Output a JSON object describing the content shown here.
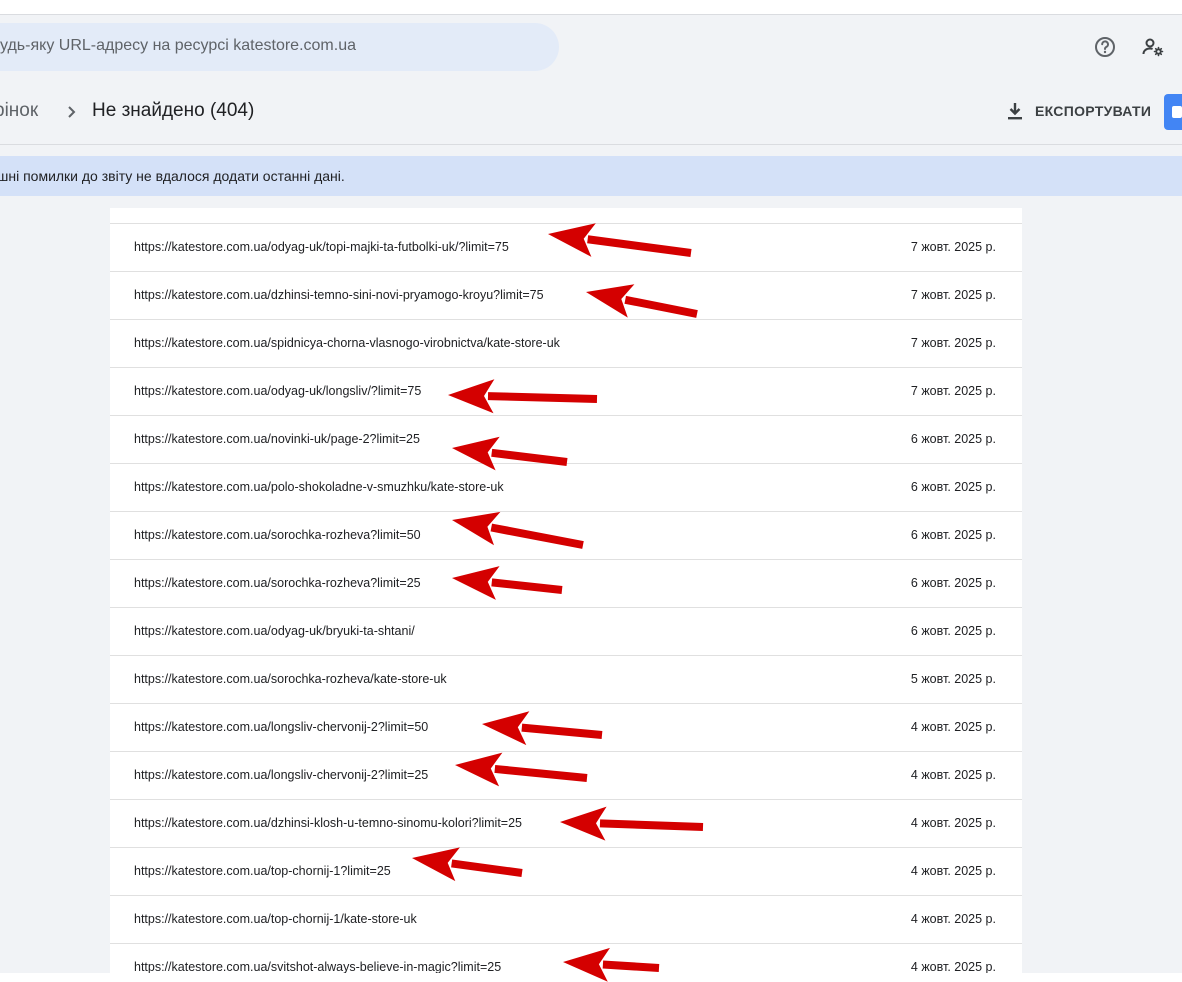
{
  "search": {
    "placeholder": "удь-яку URL-адресу на ресурсі katestore.com.ua"
  },
  "header": {
    "help_icon": "help-circle-icon",
    "account_icon": "manage-accounts-icon"
  },
  "breadcrumb": {
    "parent": "рінок",
    "current": "Не знайдено (404)"
  },
  "toolbar": {
    "export_label": "ЕКСПОРТУВАТИ",
    "export_icon": "download-icon"
  },
  "banner": {
    "text": "ішні помилки до звіту не вдалося додати останні дані."
  },
  "table": {
    "rows": [
      {
        "url": "https://katestore.com.ua/odyag-uk/topi-majki-ta-futbolki-uk/?limit=75",
        "date": "7 жовт. 2025 р."
      },
      {
        "url": "https://katestore.com.ua/dzhinsi-temno-sini-novi-pryamogo-kroyu?limit=75",
        "date": "7 жовт. 2025 р."
      },
      {
        "url": "https://katestore.com.ua/spidnicya-chorna-vlasnogo-virobnictva/kate-store-uk",
        "date": "7 жовт. 2025 р."
      },
      {
        "url": "https://katestore.com.ua/odyag-uk/longsliv/?limit=75",
        "date": "7 жовт. 2025 р."
      },
      {
        "url": "https://katestore.com.ua/novinki-uk/page-2?limit=25",
        "date": "6 жовт. 2025 р."
      },
      {
        "url": "https://katestore.com.ua/polo-shokoladne-v-smuzhku/kate-store-uk",
        "date": "6 жовт. 2025 р."
      },
      {
        "url": "https://katestore.com.ua/sorochka-rozheva?limit=50",
        "date": "6 жовт. 2025 р."
      },
      {
        "url": "https://katestore.com.ua/sorochka-rozheva?limit=25",
        "date": "6 жовт. 2025 р."
      },
      {
        "url": "https://katestore.com.ua/odyag-uk/bryuki-ta-shtani/",
        "date": "6 жовт. 2025 р."
      },
      {
        "url": "https://katestore.com.ua/sorochka-rozheva/kate-store-uk",
        "date": "5 жовт. 2025 р."
      },
      {
        "url": "https://katestore.com.ua/longsliv-chervonij-2?limit=50",
        "date": "4 жовт. 2025 р."
      },
      {
        "url": "https://katestore.com.ua/longsliv-chervonij-2?limit=25",
        "date": "4 жовт. 2025 р."
      },
      {
        "url": "https://katestore.com.ua/dzhinsi-klosh-u-temno-sinomu-kolori?limit=25",
        "date": "4 жовт. 2025 р."
      },
      {
        "url": "https://katestore.com.ua/top-chornij-1?limit=25",
        "date": "4 жовт. 2025 р."
      },
      {
        "url": "https://katestore.com.ua/top-chornij-1/kate-store-uk",
        "date": "4 жовт. 2025 р."
      },
      {
        "url": "https://katestore.com.ua/svitshot-always-believe-in-magic?limit=25",
        "date": "4 жовт. 2025 р."
      }
    ]
  },
  "annotations": {
    "arrow_color": "#d40000",
    "arrow_icon": "red-arrow-annotation"
  }
}
